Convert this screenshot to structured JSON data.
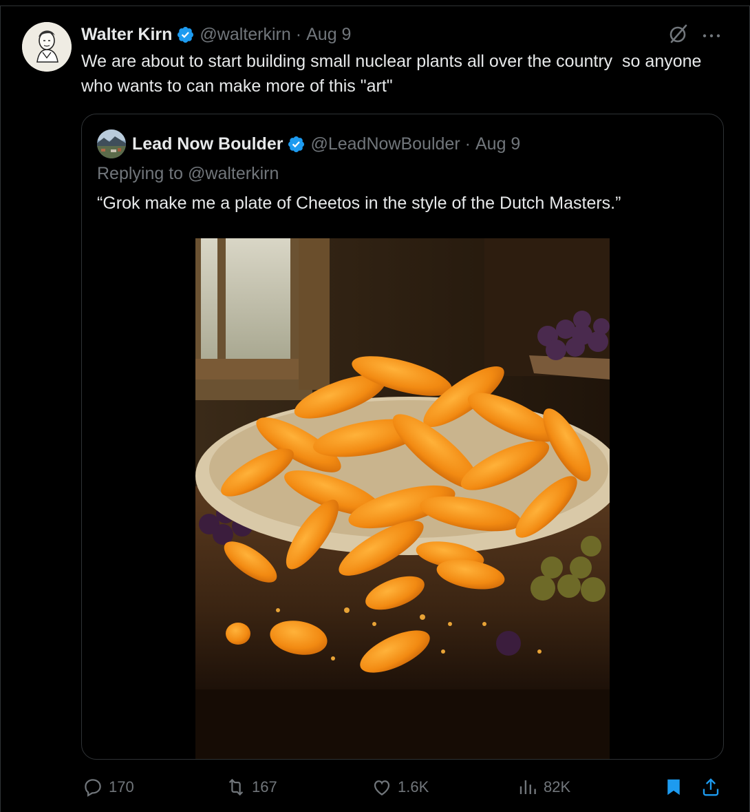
{
  "tweet": {
    "author_name": "Walter Kirn",
    "handle": "@walterkirn",
    "separator": "·",
    "date": "Aug 9",
    "text": "We are about to start building small nuclear plants all over the country  so anyone who wants to can make more of this \"art\""
  },
  "quote": {
    "author_name": "Lead Now Boulder",
    "handle": "@LeadNowBoulder",
    "separator": "·",
    "date": "Aug 9",
    "replying_prefix": "Replying to",
    "replying_to": "@walterkirn",
    "text": "“Grok make me a plate of Cheetos in the style of the Dutch Masters.”",
    "image_alt": "painting of a plate of Cheetos"
  },
  "actions": {
    "replies": "170",
    "reposts": "167",
    "likes": "1.6K",
    "views": "82K"
  },
  "icons": [
    "verified-icon",
    "grok-icon",
    "more-icon",
    "reply-icon",
    "repost-icon",
    "like-icon",
    "views-icon",
    "bookmark-icon",
    "share-icon"
  ],
  "colors": {
    "background": "#000000",
    "text": "#e7e9ea",
    "muted": "#71767b",
    "verified": "#1d9bf0",
    "border": "#2f3336"
  }
}
